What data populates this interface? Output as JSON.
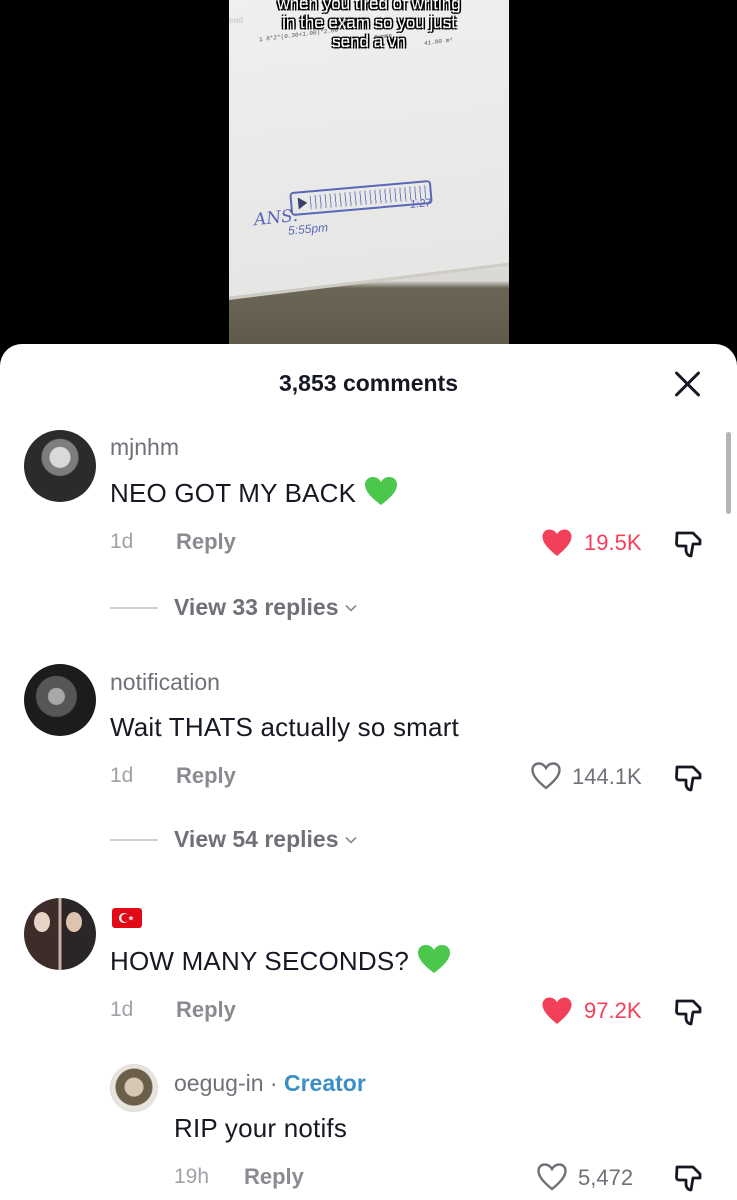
{
  "video": {
    "caption_line1": "when you tired of writing",
    "caption_line2": "in the exam so you just",
    "caption_line3": "send a vn",
    "paper_label": "end",
    "paper_formula": "1   8*2*(0.30+1.00)*2.00",
    "paper_summe": "Summe",
    "paper_value": "41.80   m²",
    "ans_label": "ANS:",
    "ans_time": "5:55pm",
    "ans_duration": "1:27"
  },
  "sheet": {
    "title": "3,853 comments"
  },
  "comments": [
    {
      "username": "mjnhm",
      "text": "NEO GOT MY BACK",
      "emoji": "green-heart",
      "time": "1d",
      "reply_label": "Reply",
      "likes": "19.5K",
      "liked": true,
      "view_replies": "View 33 replies"
    },
    {
      "username": "notification",
      "text": "Wait THATS actually so smart",
      "time": "1d",
      "reply_label": "Reply",
      "likes": "144.1K",
      "liked": false,
      "view_replies": "View 54 replies"
    },
    {
      "username_flag": "turkey-flag",
      "text": "HOW MANY SECONDS?",
      "emoji": "green-heart",
      "time": "1d",
      "reply_label": "Reply",
      "likes": "97.2K",
      "liked": true
    }
  ],
  "reply": {
    "username": "oegug-in",
    "separator": "·",
    "creator_label": "Creator",
    "text": "RIP your notifs",
    "time": "19h",
    "reply_label": "Reply",
    "likes": "5,472",
    "liked": false
  },
  "colors": {
    "liked": "#f2405a",
    "creator": "#3a8fc4",
    "emoji_heart": "#4bc84b"
  }
}
